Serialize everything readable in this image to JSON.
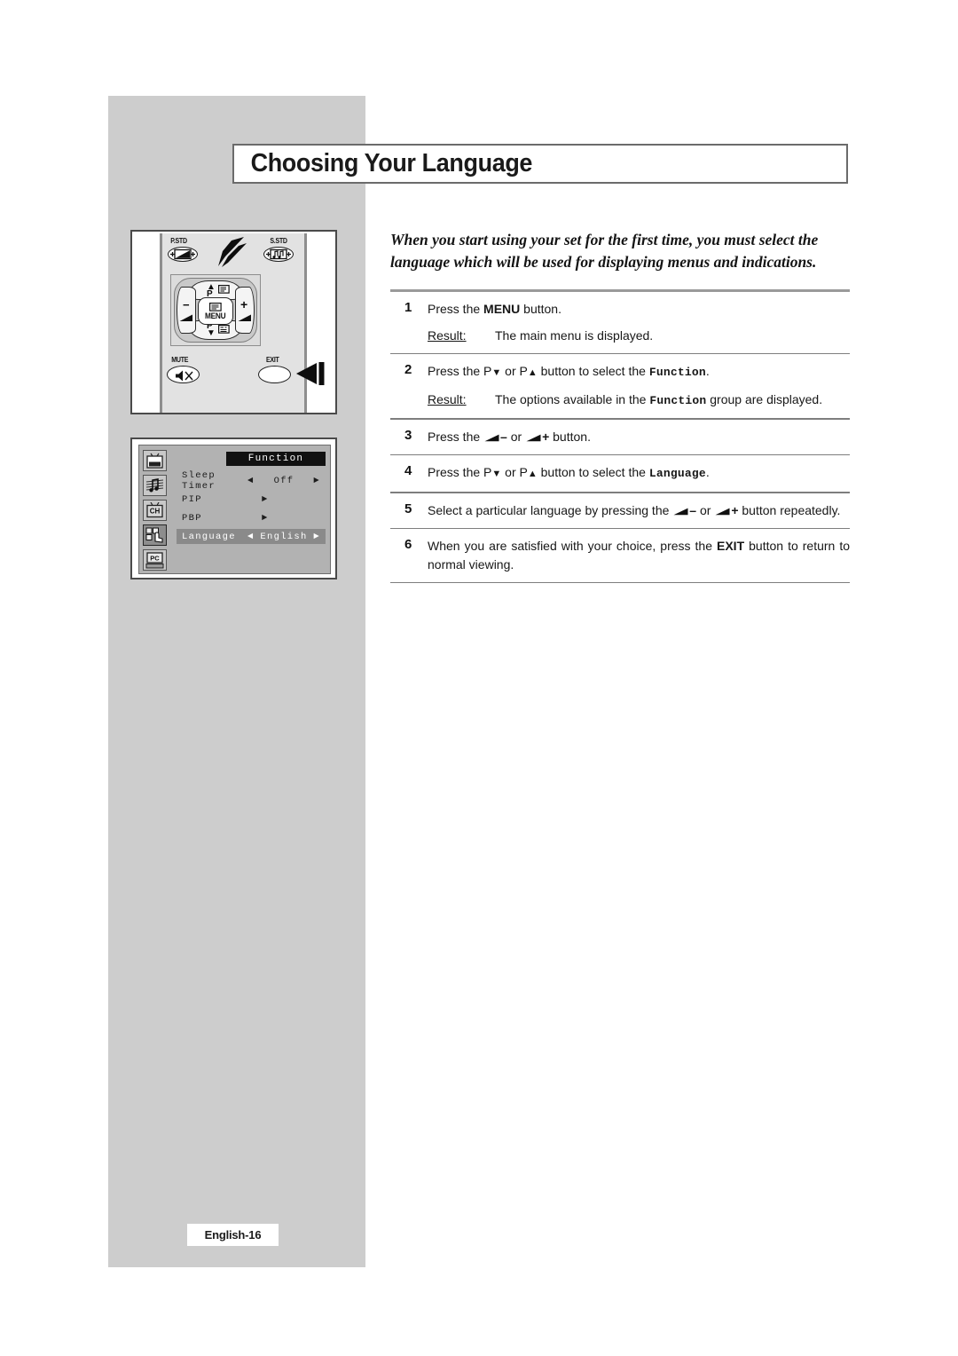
{
  "page": {
    "title": "Choosing Your Language",
    "footer_label": "English-16"
  },
  "intro": {
    "text": "When you start using your set for the first time, you must select the language which will be used for displaying menus and indications."
  },
  "steps": [
    {
      "number": "1",
      "text_before": "Press the ",
      "bold_token": "MENU",
      "text_after": " button.",
      "result_label": "Result:",
      "result_text": "The main menu is displayed."
    },
    {
      "number": "2",
      "text_a": "Press the P",
      "text_b": " or P",
      "text_c": " button to select the ",
      "mono_token": "Function",
      "text_d": ".",
      "result_label": "Result:",
      "result_a": "The options available in the ",
      "result_mono": "Function",
      "result_b": " group are displayed."
    },
    {
      "number": "3",
      "text_a": "Press the ",
      "minus": "–",
      "text_b": " or ",
      "plus": "+",
      "text_c": " button."
    },
    {
      "number": "4",
      "text_a": "Press the P",
      "text_b": " or P",
      "text_c": " button to select the ",
      "mono_token": "Language",
      "text_d": "."
    },
    {
      "number": "5",
      "text_a": "Select a particular language by pressing the ",
      "minus": "–",
      "text_b": " or ",
      "plus": "+",
      "text_c": " button repeatedly."
    },
    {
      "number": "6",
      "text_a": "When you are satisfied with your choice, press the ",
      "bold_token": "EXIT",
      "text_b": " button to return to normal viewing."
    }
  ],
  "remote": {
    "label_pstd": "P.STD",
    "label_sstd": "S.STD",
    "label_mute": "MUTE",
    "label_exit": "EXIT",
    "label_menu": "MENU",
    "key_up": "P",
    "key_down": "P",
    "key_left": "−",
    "key_right": "+"
  },
  "osd": {
    "title": "Function",
    "rows": [
      {
        "label": "Sleep Timer",
        "left_arrow": "◄",
        "value": "Off",
        "right_arrow": "►",
        "type": "value",
        "highlight": false
      },
      {
        "label": "PIP",
        "submenu_arrow": "►",
        "type": "submenu",
        "highlight": false
      },
      {
        "label": "PBP",
        "submenu_arrow": "►",
        "type": "submenu",
        "highlight": false
      },
      {
        "label": "Language",
        "left_arrow": "◄",
        "value": "English",
        "right_arrow": "►",
        "type": "value",
        "highlight": true
      }
    ],
    "icons": [
      {
        "name": "picture-icon",
        "glyph": "▣"
      },
      {
        "name": "sound-icon",
        "glyph": "♪"
      },
      {
        "name": "channel-icon",
        "glyph": "CH"
      },
      {
        "name": "function-icon",
        "glyph": "☚"
      },
      {
        "name": "pc-icon",
        "glyph": "PC"
      }
    ]
  },
  "colors": {
    "panel_gray": "#cdcdcd",
    "osd_bg": "#b2b2b2",
    "osd_highlight": "#8a8a8a",
    "rule": "#7e7e7e"
  }
}
